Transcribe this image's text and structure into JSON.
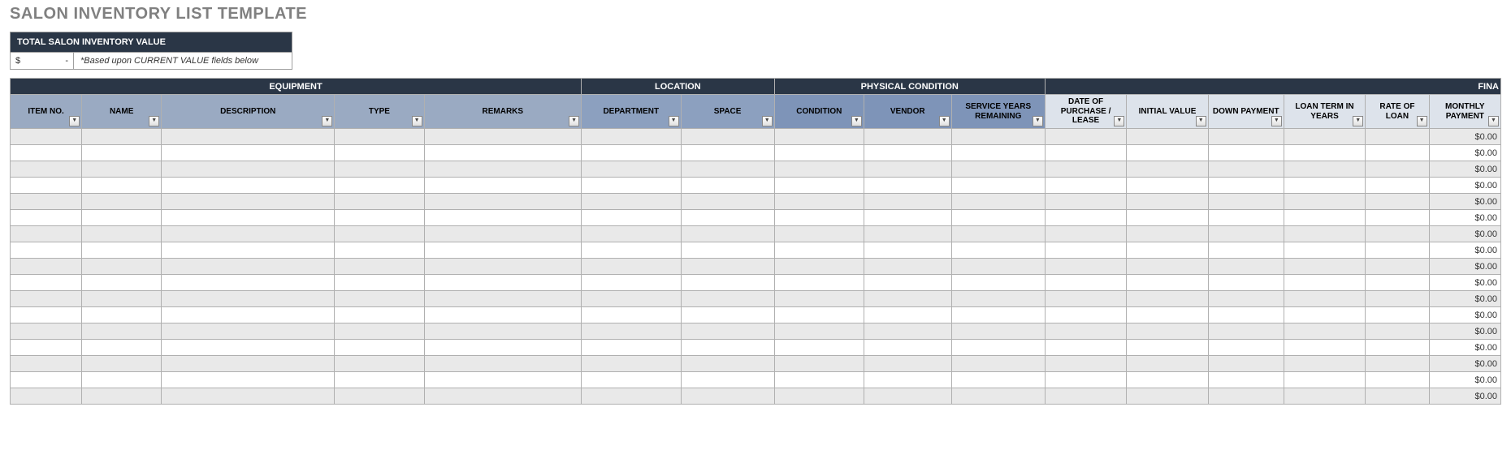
{
  "title": "SALON INVENTORY LIST TEMPLATE",
  "totalBox": {
    "header": "TOTAL SALON INVENTORY VALUE",
    "currency": "$",
    "value": "-",
    "note": "*Based upon CURRENT VALUE fields below"
  },
  "groups": {
    "equipment": "EQUIPMENT",
    "location": "LOCATION",
    "condition": "PHYSICAL CONDITION",
    "financial": "FINA"
  },
  "columns": {
    "c1": "ITEM NO.",
    "c2": "NAME",
    "c3": "DESCRIPTION",
    "c4": "TYPE",
    "c5": "REMARKS",
    "c6": "DEPARTMENT",
    "c7": "SPACE",
    "c8": "CONDITION",
    "c9": "VENDOR",
    "c10": "SERVICE YEARS REMAINING",
    "c11": "DATE OF PURCHASE / LEASE",
    "c12": "INITIAL VALUE",
    "c13": "DOWN PAYMENT",
    "c14": "LOAN TERM IN YEARS",
    "c15": "RATE OF LOAN",
    "c16": "MONTHLY PAYMENT"
  },
  "zeroMoney": "$0.00",
  "rowCount": 17
}
